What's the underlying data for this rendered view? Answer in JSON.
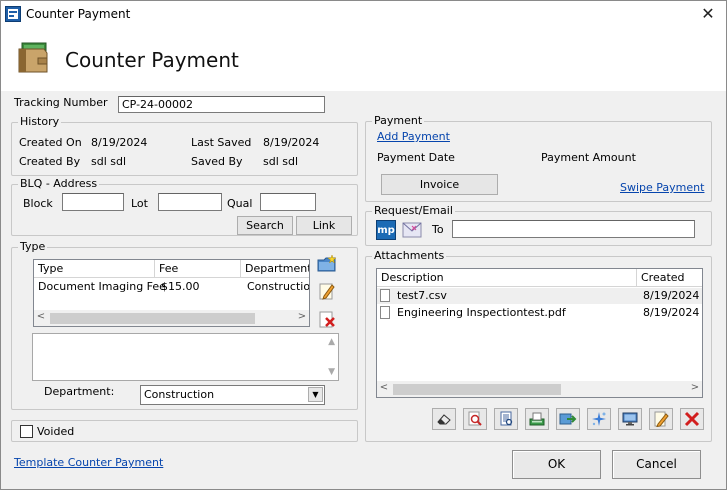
{
  "window": {
    "title": "Counter Payment",
    "close_glyph": "✕"
  },
  "header": {
    "title": "Counter Payment",
    "icon": "wallet-icon"
  },
  "tracking": {
    "label": "Tracking Number",
    "value": "CP-24-00002"
  },
  "history": {
    "legend": "History",
    "created_on_label": "Created On",
    "created_on": "8/19/2024",
    "last_saved_label": "Last Saved",
    "last_saved": "8/19/2024",
    "created_by_label": "Created By",
    "created_by": "sdl sdl",
    "saved_by_label": "Saved By",
    "saved_by": "sdl sdl"
  },
  "blq": {
    "legend": "BLQ - Address",
    "block_label": "Block",
    "block_value": "",
    "lot_label": "Lot",
    "lot_value": "",
    "qual_label": "Qual",
    "qual_value": "",
    "search_label": "Search",
    "link_label": "Link"
  },
  "type": {
    "legend": "Type",
    "columns": [
      "Type",
      "Fee",
      "Department"
    ],
    "rows": [
      {
        "type": "Document Imaging Fee",
        "fee": "$15.00",
        "department": "Construction"
      }
    ],
    "notes": "",
    "department_label": "Department:",
    "department_value": "Construction"
  },
  "voided": {
    "label": "Voided",
    "checked": false
  },
  "template_link": "Template Counter Payment",
  "payment": {
    "legend": "Payment",
    "add_link": "Add Payment",
    "date_label": "Payment Date",
    "amount_label": "Payment Amount",
    "invoice_label": "Invoice",
    "swipe_link": "Swipe Payment"
  },
  "request": {
    "legend": "Request/Email",
    "mp_text": "mp",
    "to_label": "To",
    "to_value": ""
  },
  "attachments": {
    "legend": "Attachments",
    "columns": [
      "Description",
      "Created"
    ],
    "rows": [
      {
        "name": "test7.csv",
        "created": "8/19/2024 ..."
      },
      {
        "name": "Engineering Inspectiontest.pdf",
        "created": "8/19/2024 ..."
      }
    ]
  },
  "footer": {
    "ok_label": "OK",
    "cancel_label": "Cancel"
  }
}
